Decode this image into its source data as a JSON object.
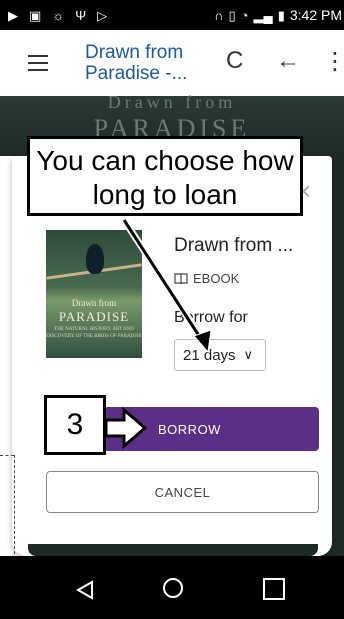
{
  "status_bar": {
    "time": "3:42 PM",
    "battery": "▮"
  },
  "toolbar": {
    "title": "Drawn from Paradise -...",
    "refresh_icon": "C",
    "back_icon": "←",
    "more_icon": "⋮"
  },
  "background": {
    "cover_title_line1": "Drawn from",
    "cover_title_line2": "PARADISE"
  },
  "dialog": {
    "book_title": "Drawn from ...",
    "format_label": "EBOOK",
    "borrow_for_label": "Borrow for",
    "selected_days": "21 days",
    "borrow_button": "BORROW",
    "cancel_button": "CANCEL",
    "close_icon": "×",
    "cover_line1": "Drawn from",
    "cover_line2": "PARADISE",
    "cover_line3": "THE NATURAL HISTORY, ART AND DISCOVERY OF THE BIRDS OF PARADISE"
  },
  "annotation": {
    "callout_text": "You can choose how long to loan",
    "step_number": "3"
  },
  "colors": {
    "accent_purple": "#5b2e87",
    "title_blue": "#1a5a9e"
  }
}
